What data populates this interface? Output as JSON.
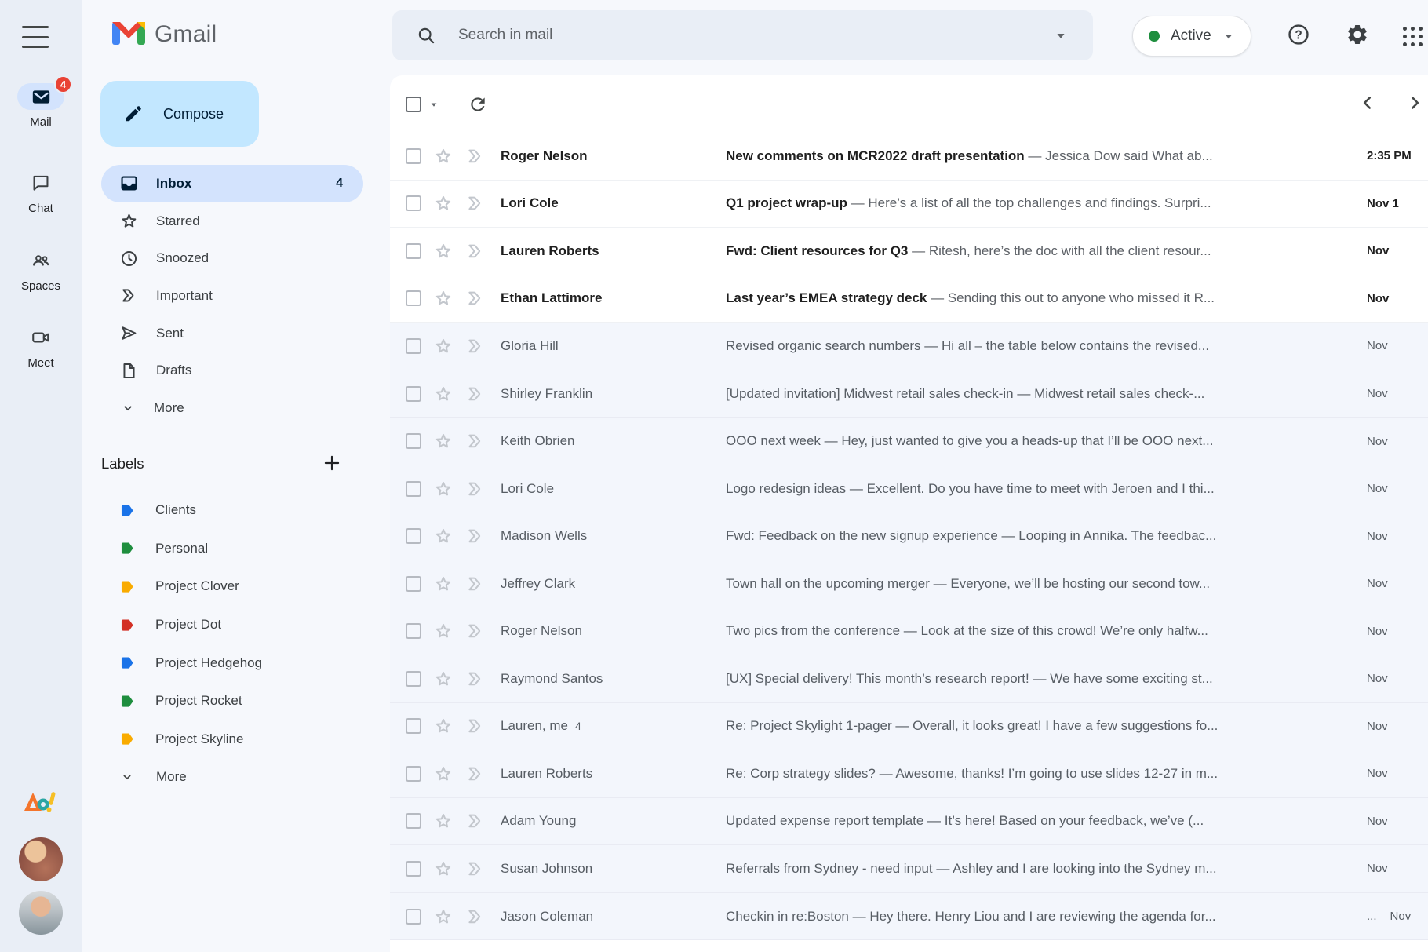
{
  "header": {
    "app_name": "Gmail",
    "search_placeholder": "Search in mail",
    "status_label": "Active"
  },
  "rail": {
    "items": [
      {
        "icon": "mail-icon",
        "label": "Mail",
        "badge": "4",
        "active": true
      },
      {
        "icon": "chat-icon",
        "label": "Chat",
        "badge": "",
        "active": false
      },
      {
        "icon": "spaces-icon",
        "label": "Spaces",
        "badge": "",
        "active": false
      },
      {
        "icon": "meet-icon",
        "label": "Meet",
        "badge": "",
        "active": false
      }
    ]
  },
  "sidebar": {
    "compose_label": "Compose",
    "nav": [
      {
        "icon": "inbox-icon",
        "label": "Inbox",
        "count": "4",
        "active": true
      },
      {
        "icon": "star-icon",
        "label": "Starred",
        "count": "",
        "active": false
      },
      {
        "icon": "clock-icon",
        "label": "Snoozed",
        "count": "",
        "active": false
      },
      {
        "icon": "important-icon",
        "label": "Important",
        "count": "",
        "active": false
      },
      {
        "icon": "send-icon",
        "label": "Sent",
        "count": "",
        "active": false
      },
      {
        "icon": "draft-icon",
        "label": "Drafts",
        "count": "",
        "active": false
      },
      {
        "icon": "chevron-down-icon",
        "label": "More",
        "count": "",
        "active": false
      }
    ],
    "labels_header": "Labels",
    "labels": [
      {
        "label": "Clients",
        "color": "#1a73e8"
      },
      {
        "label": "Personal",
        "color": "#1e8e3e"
      },
      {
        "label": "Project Clover",
        "color": "#f9ab00"
      },
      {
        "label": "Project Dot",
        "color": "#d33025"
      },
      {
        "label": "Project Hedgehog",
        "color": "#1a73e8"
      },
      {
        "label": "Project Rocket",
        "color": "#1e8e3e"
      },
      {
        "label": "Project Skyline",
        "color": "#f9ab00"
      },
      {
        "label": "More",
        "color": "",
        "is_more": true
      }
    ]
  },
  "list": {
    "separator": "—",
    "emails": [
      {
        "sender": "Roger Nelson",
        "thread_count": "",
        "subject": "New comments on MCR2022 draft presentation",
        "snippet": "Jessica Dow said What ab...",
        "time": "2:35 PM",
        "time_prefix": "",
        "unread": true
      },
      {
        "sender": "Lori Cole",
        "thread_count": "",
        "subject": "Q1 project wrap-up",
        "snippet": "Here’s a list of all the top challenges and findings. Surpri...",
        "time": "Nov 1",
        "time_prefix": "",
        "unread": true
      },
      {
        "sender": "Lauren Roberts",
        "thread_count": "",
        "subject": "Fwd: Client resources for Q3",
        "snippet": "Ritesh, here’s the doc with all the client resour...",
        "time": "Nov",
        "time_prefix": "",
        "unread": true
      },
      {
        "sender": "Ethan Lattimore",
        "thread_count": "",
        "subject": "Last year’s EMEA strategy deck",
        "snippet": "Sending this out to anyone who missed it R...",
        "time": "Nov",
        "time_prefix": "",
        "unread": true
      },
      {
        "sender": "Gloria Hill",
        "thread_count": "",
        "subject": "Revised organic search numbers",
        "snippet": "Hi all – the table below contains the revised...",
        "time": "Nov",
        "time_prefix": "",
        "unread": false
      },
      {
        "sender": "Shirley Franklin",
        "thread_count": "",
        "subject": "[Updated invitation] Midwest retail sales check-in",
        "snippet": "Midwest retail sales check-...",
        "time": "Nov",
        "time_prefix": "",
        "unread": false
      },
      {
        "sender": "Keith Obrien",
        "thread_count": "",
        "subject": "OOO next week",
        "snippet": "Hey, just wanted to give you a heads-up that I’ll be OOO next...",
        "time": "Nov",
        "time_prefix": "",
        "unread": false
      },
      {
        "sender": "Lori Cole",
        "thread_count": "",
        "subject": "Logo redesign ideas",
        "snippet": "Excellent. Do you have time to meet with Jeroen and I thi...",
        "time": "Nov",
        "time_prefix": "",
        "unread": false
      },
      {
        "sender": "Madison Wells",
        "thread_count": "",
        "subject": "Fwd: Feedback on the new signup experience",
        "snippet": "Looping in Annika. The feedbac...",
        "time": "Nov",
        "time_prefix": "",
        "unread": false
      },
      {
        "sender": "Jeffrey Clark",
        "thread_count": "",
        "subject": "Town hall on the upcoming merger",
        "snippet": "Everyone, we’ll be hosting our second tow...",
        "time": "Nov",
        "time_prefix": "",
        "unread": false
      },
      {
        "sender": "Roger Nelson",
        "thread_count": "",
        "subject": "Two pics from the conference",
        "snippet": "Look at the size of this crowd! We’re only halfw...",
        "time": "Nov",
        "time_prefix": "",
        "unread": false
      },
      {
        "sender": "Raymond Santos",
        "thread_count": "",
        "subject": "[UX] Special delivery! This month’s research report!",
        "snippet": "We have some exciting st...",
        "time": "Nov",
        "time_prefix": "",
        "unread": false
      },
      {
        "sender": "Lauren, me",
        "thread_count": "4",
        "subject": "Re: Project Skylight 1-pager",
        "snippet": "Overall, it looks great! I have a few suggestions fo...",
        "time": "Nov",
        "time_prefix": "",
        "unread": false
      },
      {
        "sender": "Lauren Roberts",
        "thread_count": "",
        "subject": "Re: Corp strategy slides?",
        "snippet": "Awesome, thanks! I’m going to use slides 12-27 in m...",
        "time": "Nov",
        "time_prefix": "",
        "unread": false
      },
      {
        "sender": "Adam Young",
        "thread_count": "",
        "subject": "Updated expense report template",
        "snippet": "It’s here! Based on your feedback, we’ve (...",
        "time": "Nov",
        "time_prefix": "",
        "unread": false
      },
      {
        "sender": "Susan Johnson",
        "thread_count": "",
        "subject": "Referrals from Sydney - need input",
        "snippet": "Ashley and I are looking into the Sydney m...",
        "time": "Nov",
        "time_prefix": "",
        "unread": false
      },
      {
        "sender": "Jason Coleman",
        "thread_count": "",
        "subject": "Checkin in re:Boston",
        "snippet": "Hey there. Henry Liou and I are reviewing the agenda for...",
        "time": "Nov",
        "time_prefix": "...",
        "unread": false
      }
    ]
  },
  "colors": {
    "page_bg": "#f6f8fc",
    "rail_bg": "#e9eef6",
    "compose_bg": "#c2e7ff",
    "selected_bg": "#d3e3fd",
    "read_row_bg": "#f3f6fc",
    "unread_row_bg": "#ffffff",
    "badge_red": "#e94235",
    "status_green": "#1e8e3e",
    "accent_blue": "#0b57d0"
  }
}
